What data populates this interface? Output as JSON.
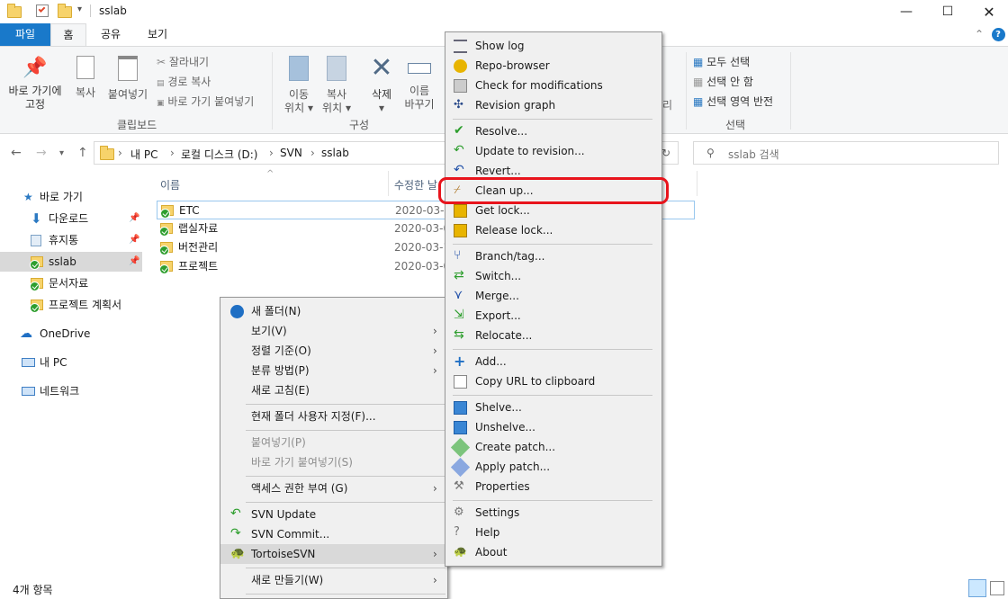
{
  "window": {
    "title": "sslab"
  },
  "ribbon_tabs": [
    "파일",
    "홈",
    "공유",
    "보기"
  ],
  "ribbon": {
    "pin_label_1": "바로 가기에",
    "pin_label_2": "고정",
    "copy_label": "복사",
    "paste_label": "붙여넣기",
    "cut_label": "잘라내기",
    "copy_path_label": "경로 복사",
    "paste_shortcut_label": "바로 가기 붙여넣기",
    "clipboard_group": "클립보드",
    "move_to_1": "이동",
    "move_to_2": "위치",
    "copy_to_1": "복사",
    "copy_to_2": "위치",
    "delete_label": "삭제",
    "rename_1": "이름",
    "rename_2": "바꾸기",
    "organize_group": "구성",
    "open_partial": "리",
    "select_all": "모두 선택",
    "select_none": "선택 안 함",
    "invert_selection": "선택 영역 반전",
    "select_group": "선택"
  },
  "address": {
    "crumbs": [
      "내 PC",
      "로컬 디스크 (D:)",
      "SVN",
      "sslab"
    ],
    "search_placeholder": "sslab 검색"
  },
  "nav_pane": {
    "quick_access": "바로 가기",
    "items": [
      "다운로드",
      "휴지통",
      "sslab",
      "문서자료",
      "프로젝트 계획서"
    ],
    "onedrive": "OneDrive",
    "this_pc": "내 PC",
    "network": "네트워크"
  },
  "file_list": {
    "col_name": "이름",
    "col_modified": "수정한 날",
    "rows": [
      {
        "name": "ETC",
        "date": "2020-03-"
      },
      {
        "name": "랩실자료",
        "date": "2020-03-0"
      },
      {
        "name": "버전관리",
        "date": "2020-03-1"
      },
      {
        "name": "프로젝트",
        "date": "2020-03-0"
      }
    ]
  },
  "status": {
    "count": "4개 항목"
  },
  "context_menu": {
    "items": [
      "새 폴더(N)",
      "보기(V)",
      "정렬 기준(O)",
      "분류 방법(P)",
      "새로 고침(E)",
      "현재 폴더 사용자 지정(F)...",
      "붙여넣기(P)",
      "바로 가기 붙여넣기(S)",
      "액세스 권한 부여 (G)",
      "SVN Update",
      "SVN Commit...",
      "TortoiseSVN",
      "새로 만들기(W)"
    ]
  },
  "svn_menu": {
    "items": [
      "Show log",
      "Repo-browser",
      "Check for modifications",
      "Revision graph",
      "Resolve...",
      "Update to revision...",
      "Revert...",
      "Clean up...",
      "Get lock...",
      "Release lock...",
      "Branch/tag...",
      "Switch...",
      "Merge...",
      "Export...",
      "Relocate...",
      "Add...",
      "Copy URL to clipboard",
      "Shelve...",
      "Unshelve...",
      "Create patch...",
      "Apply patch...",
      "Properties",
      "Settings",
      "Help",
      "About"
    ]
  },
  "colors": {
    "accent": "#1979ca",
    "highlight": "#e8141c",
    "selected": "#cce8ff"
  }
}
